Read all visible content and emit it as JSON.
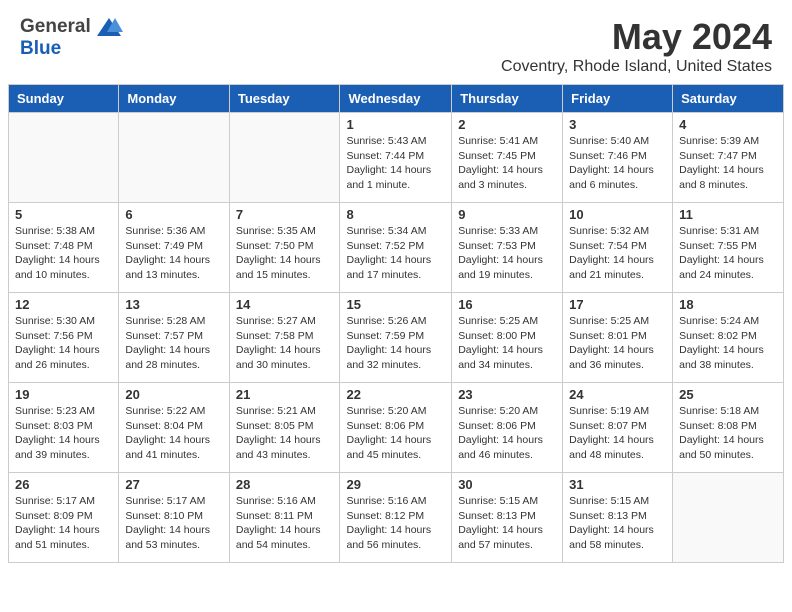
{
  "header": {
    "logo_general": "General",
    "logo_blue": "Blue",
    "title": "May 2024",
    "location": "Coventry, Rhode Island, United States"
  },
  "columns": [
    "Sunday",
    "Monday",
    "Tuesday",
    "Wednesday",
    "Thursday",
    "Friday",
    "Saturday"
  ],
  "weeks": [
    [
      {
        "day": "",
        "info": ""
      },
      {
        "day": "",
        "info": ""
      },
      {
        "day": "",
        "info": ""
      },
      {
        "day": "1",
        "info": "Sunrise: 5:43 AM\nSunset: 7:44 PM\nDaylight: 14 hours\nand 1 minute."
      },
      {
        "day": "2",
        "info": "Sunrise: 5:41 AM\nSunset: 7:45 PM\nDaylight: 14 hours\nand 3 minutes."
      },
      {
        "day": "3",
        "info": "Sunrise: 5:40 AM\nSunset: 7:46 PM\nDaylight: 14 hours\nand 6 minutes."
      },
      {
        "day": "4",
        "info": "Sunrise: 5:39 AM\nSunset: 7:47 PM\nDaylight: 14 hours\nand 8 minutes."
      }
    ],
    [
      {
        "day": "5",
        "info": "Sunrise: 5:38 AM\nSunset: 7:48 PM\nDaylight: 14 hours\nand 10 minutes."
      },
      {
        "day": "6",
        "info": "Sunrise: 5:36 AM\nSunset: 7:49 PM\nDaylight: 14 hours\nand 13 minutes."
      },
      {
        "day": "7",
        "info": "Sunrise: 5:35 AM\nSunset: 7:50 PM\nDaylight: 14 hours\nand 15 minutes."
      },
      {
        "day": "8",
        "info": "Sunrise: 5:34 AM\nSunset: 7:52 PM\nDaylight: 14 hours\nand 17 minutes."
      },
      {
        "day": "9",
        "info": "Sunrise: 5:33 AM\nSunset: 7:53 PM\nDaylight: 14 hours\nand 19 minutes."
      },
      {
        "day": "10",
        "info": "Sunrise: 5:32 AM\nSunset: 7:54 PM\nDaylight: 14 hours\nand 21 minutes."
      },
      {
        "day": "11",
        "info": "Sunrise: 5:31 AM\nSunset: 7:55 PM\nDaylight: 14 hours\nand 24 minutes."
      }
    ],
    [
      {
        "day": "12",
        "info": "Sunrise: 5:30 AM\nSunset: 7:56 PM\nDaylight: 14 hours\nand 26 minutes."
      },
      {
        "day": "13",
        "info": "Sunrise: 5:28 AM\nSunset: 7:57 PM\nDaylight: 14 hours\nand 28 minutes."
      },
      {
        "day": "14",
        "info": "Sunrise: 5:27 AM\nSunset: 7:58 PM\nDaylight: 14 hours\nand 30 minutes."
      },
      {
        "day": "15",
        "info": "Sunrise: 5:26 AM\nSunset: 7:59 PM\nDaylight: 14 hours\nand 32 minutes."
      },
      {
        "day": "16",
        "info": "Sunrise: 5:25 AM\nSunset: 8:00 PM\nDaylight: 14 hours\nand 34 minutes."
      },
      {
        "day": "17",
        "info": "Sunrise: 5:25 AM\nSunset: 8:01 PM\nDaylight: 14 hours\nand 36 minutes."
      },
      {
        "day": "18",
        "info": "Sunrise: 5:24 AM\nSunset: 8:02 PM\nDaylight: 14 hours\nand 38 minutes."
      }
    ],
    [
      {
        "day": "19",
        "info": "Sunrise: 5:23 AM\nSunset: 8:03 PM\nDaylight: 14 hours\nand 39 minutes."
      },
      {
        "day": "20",
        "info": "Sunrise: 5:22 AM\nSunset: 8:04 PM\nDaylight: 14 hours\nand 41 minutes."
      },
      {
        "day": "21",
        "info": "Sunrise: 5:21 AM\nSunset: 8:05 PM\nDaylight: 14 hours\nand 43 minutes."
      },
      {
        "day": "22",
        "info": "Sunrise: 5:20 AM\nSunset: 8:06 PM\nDaylight: 14 hours\nand 45 minutes."
      },
      {
        "day": "23",
        "info": "Sunrise: 5:20 AM\nSunset: 8:06 PM\nDaylight: 14 hours\nand 46 minutes."
      },
      {
        "day": "24",
        "info": "Sunrise: 5:19 AM\nSunset: 8:07 PM\nDaylight: 14 hours\nand 48 minutes."
      },
      {
        "day": "25",
        "info": "Sunrise: 5:18 AM\nSunset: 8:08 PM\nDaylight: 14 hours\nand 50 minutes."
      }
    ],
    [
      {
        "day": "26",
        "info": "Sunrise: 5:17 AM\nSunset: 8:09 PM\nDaylight: 14 hours\nand 51 minutes."
      },
      {
        "day": "27",
        "info": "Sunrise: 5:17 AM\nSunset: 8:10 PM\nDaylight: 14 hours\nand 53 minutes."
      },
      {
        "day": "28",
        "info": "Sunrise: 5:16 AM\nSunset: 8:11 PM\nDaylight: 14 hours\nand 54 minutes."
      },
      {
        "day": "29",
        "info": "Sunrise: 5:16 AM\nSunset: 8:12 PM\nDaylight: 14 hours\nand 56 minutes."
      },
      {
        "day": "30",
        "info": "Sunrise: 5:15 AM\nSunset: 8:13 PM\nDaylight: 14 hours\nand 57 minutes."
      },
      {
        "day": "31",
        "info": "Sunrise: 5:15 AM\nSunset: 8:13 PM\nDaylight: 14 hours\nand 58 minutes."
      },
      {
        "day": "",
        "info": ""
      }
    ]
  ]
}
